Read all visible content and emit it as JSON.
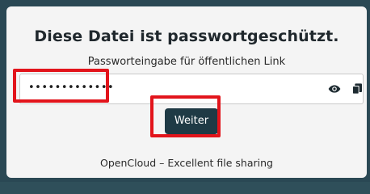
{
  "heading": "Diese Datei ist passwortgeschützt.",
  "password": {
    "label": "Passworteingabe für öffentlichen Link",
    "value": "•••••••••••••"
  },
  "icons": {
    "show_password": "eye-icon",
    "copy": "copy-icon"
  },
  "submit_label": "Weiter",
  "footer": "OpenCloud – Excellent file sharing",
  "colors": {
    "background": "#2a4854",
    "card": "#f4f4f4",
    "button": "#1f3a45",
    "highlight": "#e2141b"
  }
}
